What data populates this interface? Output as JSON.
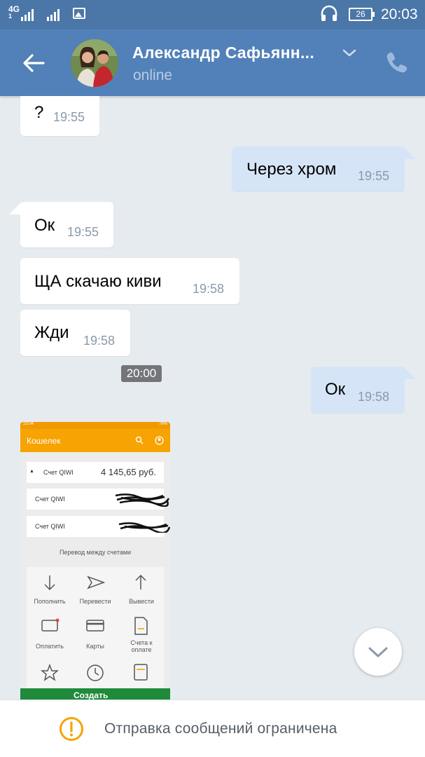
{
  "status_bar": {
    "network": "4G",
    "network_sub": "1",
    "sim1": "1",
    "sim2": "2",
    "battery": "26",
    "time": "20:03"
  },
  "header": {
    "name": "Александр Сафьянн...",
    "status": "online"
  },
  "messages": [
    {
      "dir": "in",
      "text": "?",
      "time": "19:55"
    },
    {
      "dir": "out",
      "text": "Через хром",
      "time": "19:55"
    },
    {
      "dir": "in",
      "text": "Ок",
      "time": "19:55"
    },
    {
      "dir": "in",
      "text": "ЩА скачаю киви",
      "time": "19:58"
    },
    {
      "dir": "in",
      "text": "Жди",
      "time": "19:58"
    },
    {
      "dir": "out",
      "text": "Ок",
      "time": "19:58"
    }
  ],
  "photo": {
    "time": "20:00",
    "status_time": "23:04",
    "status_battery": "78%",
    "app_title": "Кошелек",
    "account1_label": "Счет QIWI",
    "account1_amount": "4 145,65 руб.",
    "account2_label": "Счет QIWI",
    "account3_label": "Счет QIWI",
    "transfer_label": "Перевод между счетами",
    "actions": [
      "Пополнить",
      "Перевести",
      "Вывести",
      "Оплатить",
      "Карты",
      "Счета к оплате"
    ],
    "bottom_button": "Создать"
  },
  "footer": {
    "text": "Отправка сообщений ограничена"
  },
  "colors": {
    "status_bar": "#4b77a8",
    "header": "#5181b8",
    "incoming": "#ffffff",
    "outgoing": "#d5e5f7",
    "qiwi_orange": "#f7a301",
    "warning": "#f7a301"
  }
}
